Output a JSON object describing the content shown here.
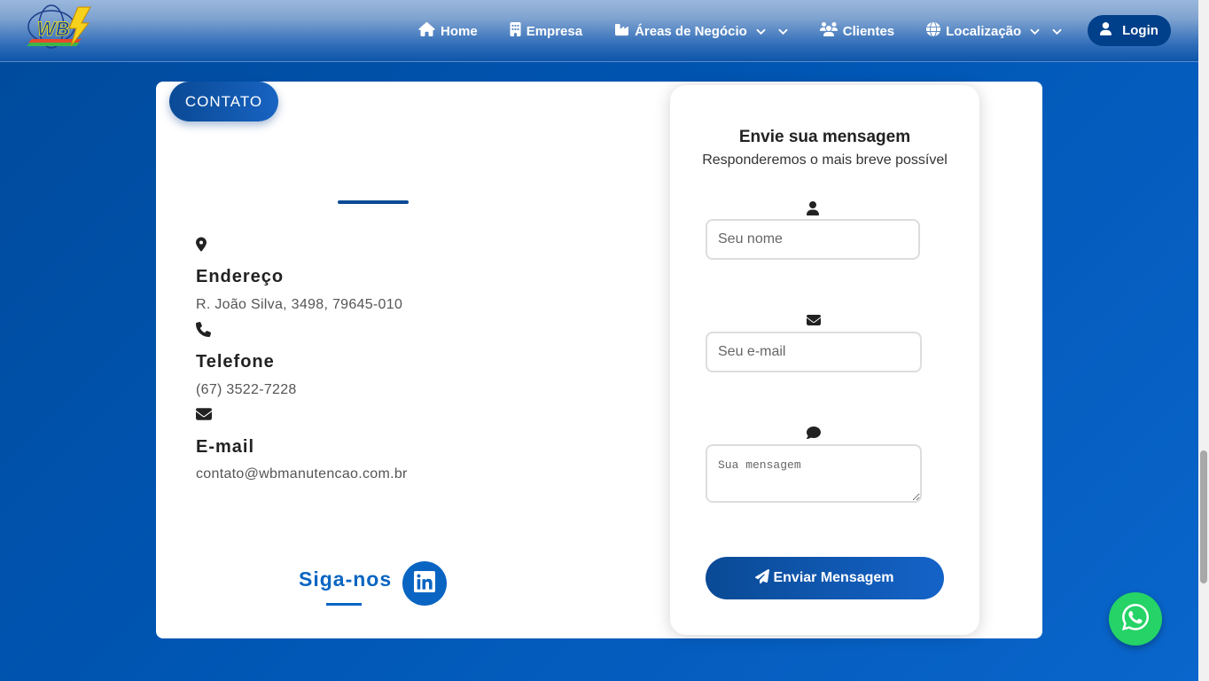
{
  "header": {
    "logo_text": "WB",
    "nav": [
      {
        "label": "Home",
        "icon": "home-icon"
      },
      {
        "label": "Empresa",
        "icon": "building-icon"
      },
      {
        "label": "Áreas de Negócio",
        "icon": "industry-icon",
        "dropdown": true
      },
      {
        "label": "Clientes",
        "icon": "users-icon"
      },
      {
        "label": "Localização",
        "icon": "globe-icon",
        "dropdown": true
      }
    ],
    "login_label": "Login"
  },
  "contact": {
    "badge": "CONTATO",
    "address_title": "Endereço",
    "address_value": "R. João Silva, 3498, 79645-010",
    "phone_title": "Telefone",
    "phone_value": "(67) 3522-7228",
    "email_title": "E-mail",
    "email_value": "contato@wbmanutencao.com.br",
    "follow_label": "Siga-nos"
  },
  "form": {
    "title": "Envie sua mensagem",
    "subtitle": "Responderemos o mais breve possível",
    "name_placeholder": "Seu nome",
    "email_placeholder": "Seu e-mail",
    "message_placeholder": "Sua mensagem",
    "submit_label": "Enviar Mensagem"
  },
  "colors": {
    "primary": "#0a4a95",
    "accent": "#0a65c2",
    "whatsapp": "#25d366"
  }
}
